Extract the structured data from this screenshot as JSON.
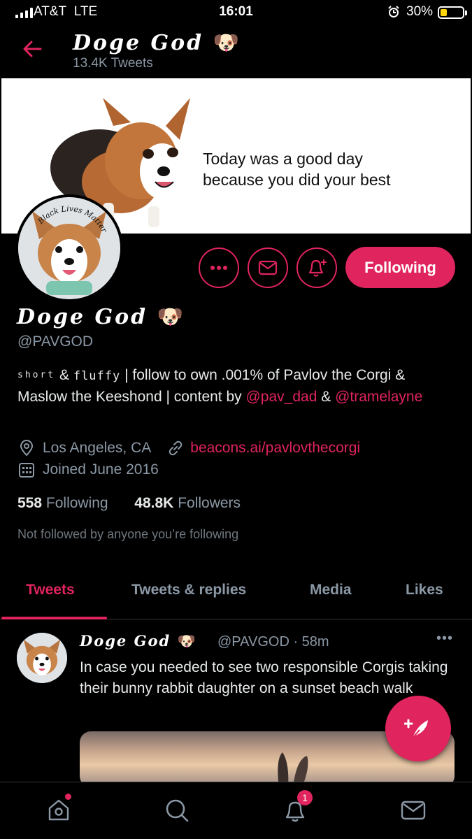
{
  "status_bar": {
    "carrier": "AT&T",
    "network": "LTE",
    "time": "16:01",
    "battery": "30%"
  },
  "header": {
    "name": "Doge God",
    "name_emoji": "🐶",
    "tweet_count": "13.4K Tweets"
  },
  "banner": {
    "line1": "Today was a good day",
    "line2": "because you did your best"
  },
  "avatar": {
    "ring_text": "Black Lives Matter"
  },
  "actions": {
    "following_label": "Following"
  },
  "profile": {
    "name": "Doge God",
    "name_emoji": "🐶",
    "handle": "@PAVGOD",
    "bio_short": "short",
    "bio_amp": " & ",
    "bio_fluffy": "fluffy",
    "bio_main": " | follow to own .001% of Pavlov the Corgi & Maslow the Keeshond | content by ",
    "bio_mention1": "@pav_dad",
    "bio_and": " & ",
    "bio_mention2": "@tramelayne",
    "location": "Los Angeles, CA",
    "website": "beacons.ai/pavlovthecorgi",
    "joined": "Joined June 2016",
    "following_count": "558",
    "following_label": "Following",
    "followers_count": "48.8K",
    "followers_label": "Followers",
    "not_followed": "Not followed by anyone you’re following"
  },
  "tabs": [
    {
      "label": "Tweets",
      "active": true
    },
    {
      "label": "Tweets & replies",
      "active": false
    },
    {
      "label": "Media",
      "active": false
    },
    {
      "label": "Likes",
      "active": false
    }
  ],
  "tweet": {
    "name": "Doge God",
    "name_emoji": "🐶",
    "handle_time": "@PAVGOD · 58m",
    "text": "In case you needed to see two responsible Corgis taking their bunny rabbit daughter on a sunset beach walk"
  },
  "bottom_nav": {
    "notification_badge": "1"
  },
  "colors": {
    "accent": "#e0245e",
    "background": "#000000",
    "muted": "#8b98a5"
  }
}
